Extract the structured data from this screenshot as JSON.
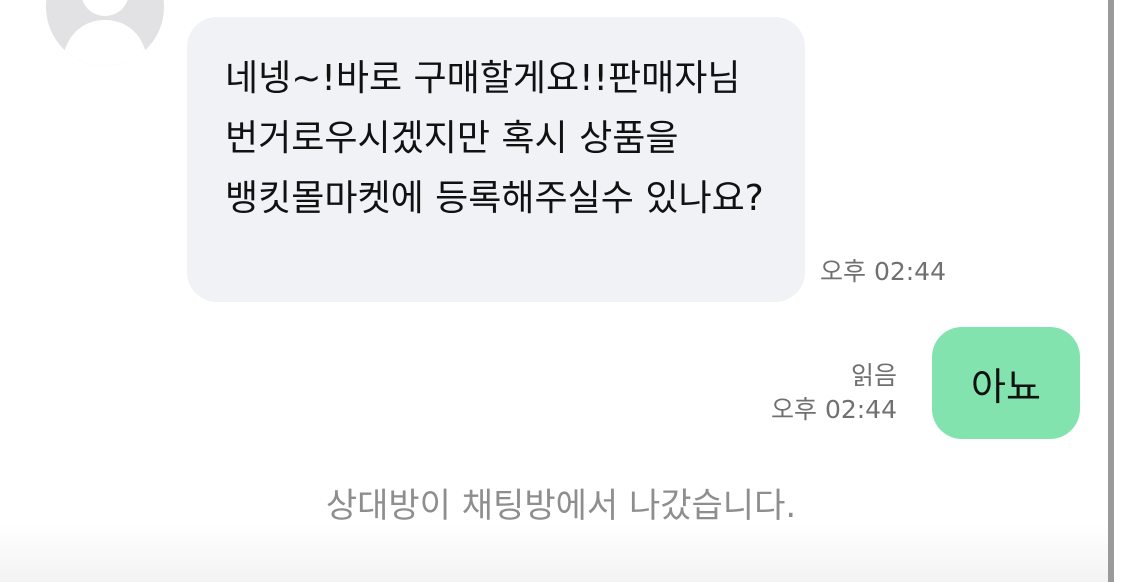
{
  "conversation": {
    "incoming_message": {
      "text": "네넹~!바로 구매할게요!!판매자님 번거로우시겠지만 혹시 상품을 뱅킷몰마켓에 등록해주실수 있나요?",
      "time": "오후 02:44"
    },
    "outgoing_message": {
      "text": "아뇨",
      "read_status": "읽음",
      "time": "오후 02:44"
    },
    "system_notice": "상대방이 채팅방에서 나갔습니다."
  },
  "colors": {
    "incoming_bubble": "#f1f2f6",
    "outgoing_bubble": "#82e3ae",
    "meta_text": "#707070",
    "system_text": "#8e8e8e",
    "avatar_bg": "#e2e2e4"
  },
  "icons": {
    "avatar": "default-user-silhouette-icon"
  }
}
